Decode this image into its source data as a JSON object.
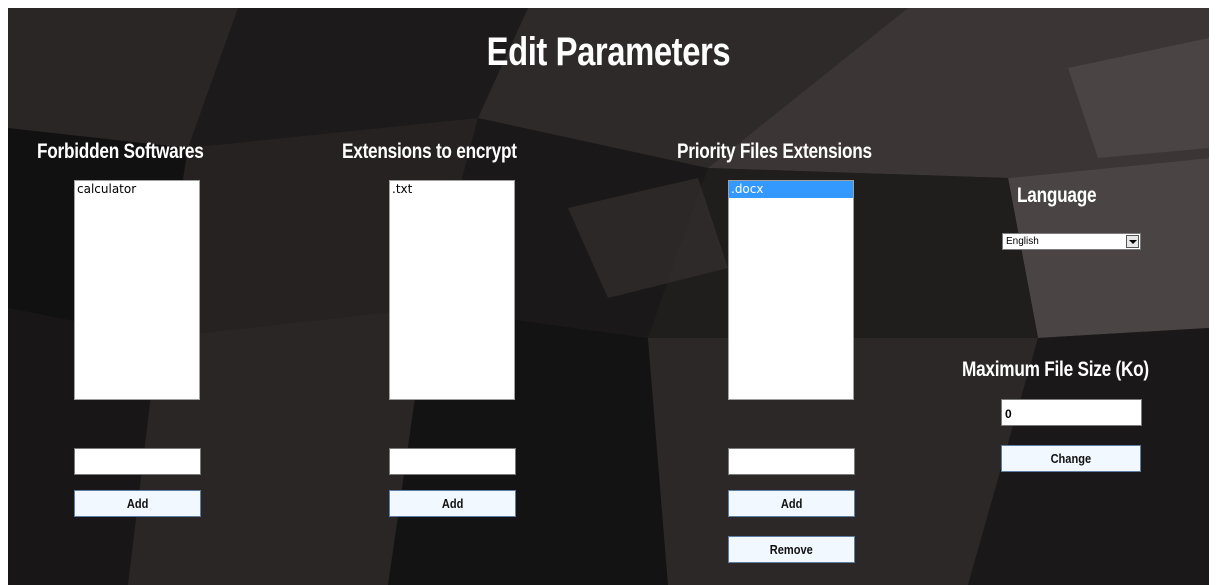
{
  "window": {
    "title": "Edit Parameters"
  },
  "forbidden_softwares": {
    "heading": "Forbidden Softwares",
    "items": [
      "calculator"
    ],
    "input_value": "",
    "add_label": "Add"
  },
  "extensions_to_encrypt": {
    "heading": "Extensions to encrypt",
    "items": [
      ".txt"
    ],
    "input_value": "",
    "add_label": "Add"
  },
  "priority_files": {
    "heading": "Priority Files Extensions",
    "items": [
      ".docx"
    ],
    "selected_item": ".docx",
    "input_value": "",
    "add_label": "Add",
    "remove_label": "Remove"
  },
  "language": {
    "heading": "Language",
    "selected": "English"
  },
  "max_file_size": {
    "heading": "Maximum File Size (Ko)",
    "value": "0",
    "change_label": "Change"
  },
  "colors": {
    "selection": "#3399ff",
    "button_bg": "#f2f8ff",
    "text_light": "#ffffff"
  }
}
